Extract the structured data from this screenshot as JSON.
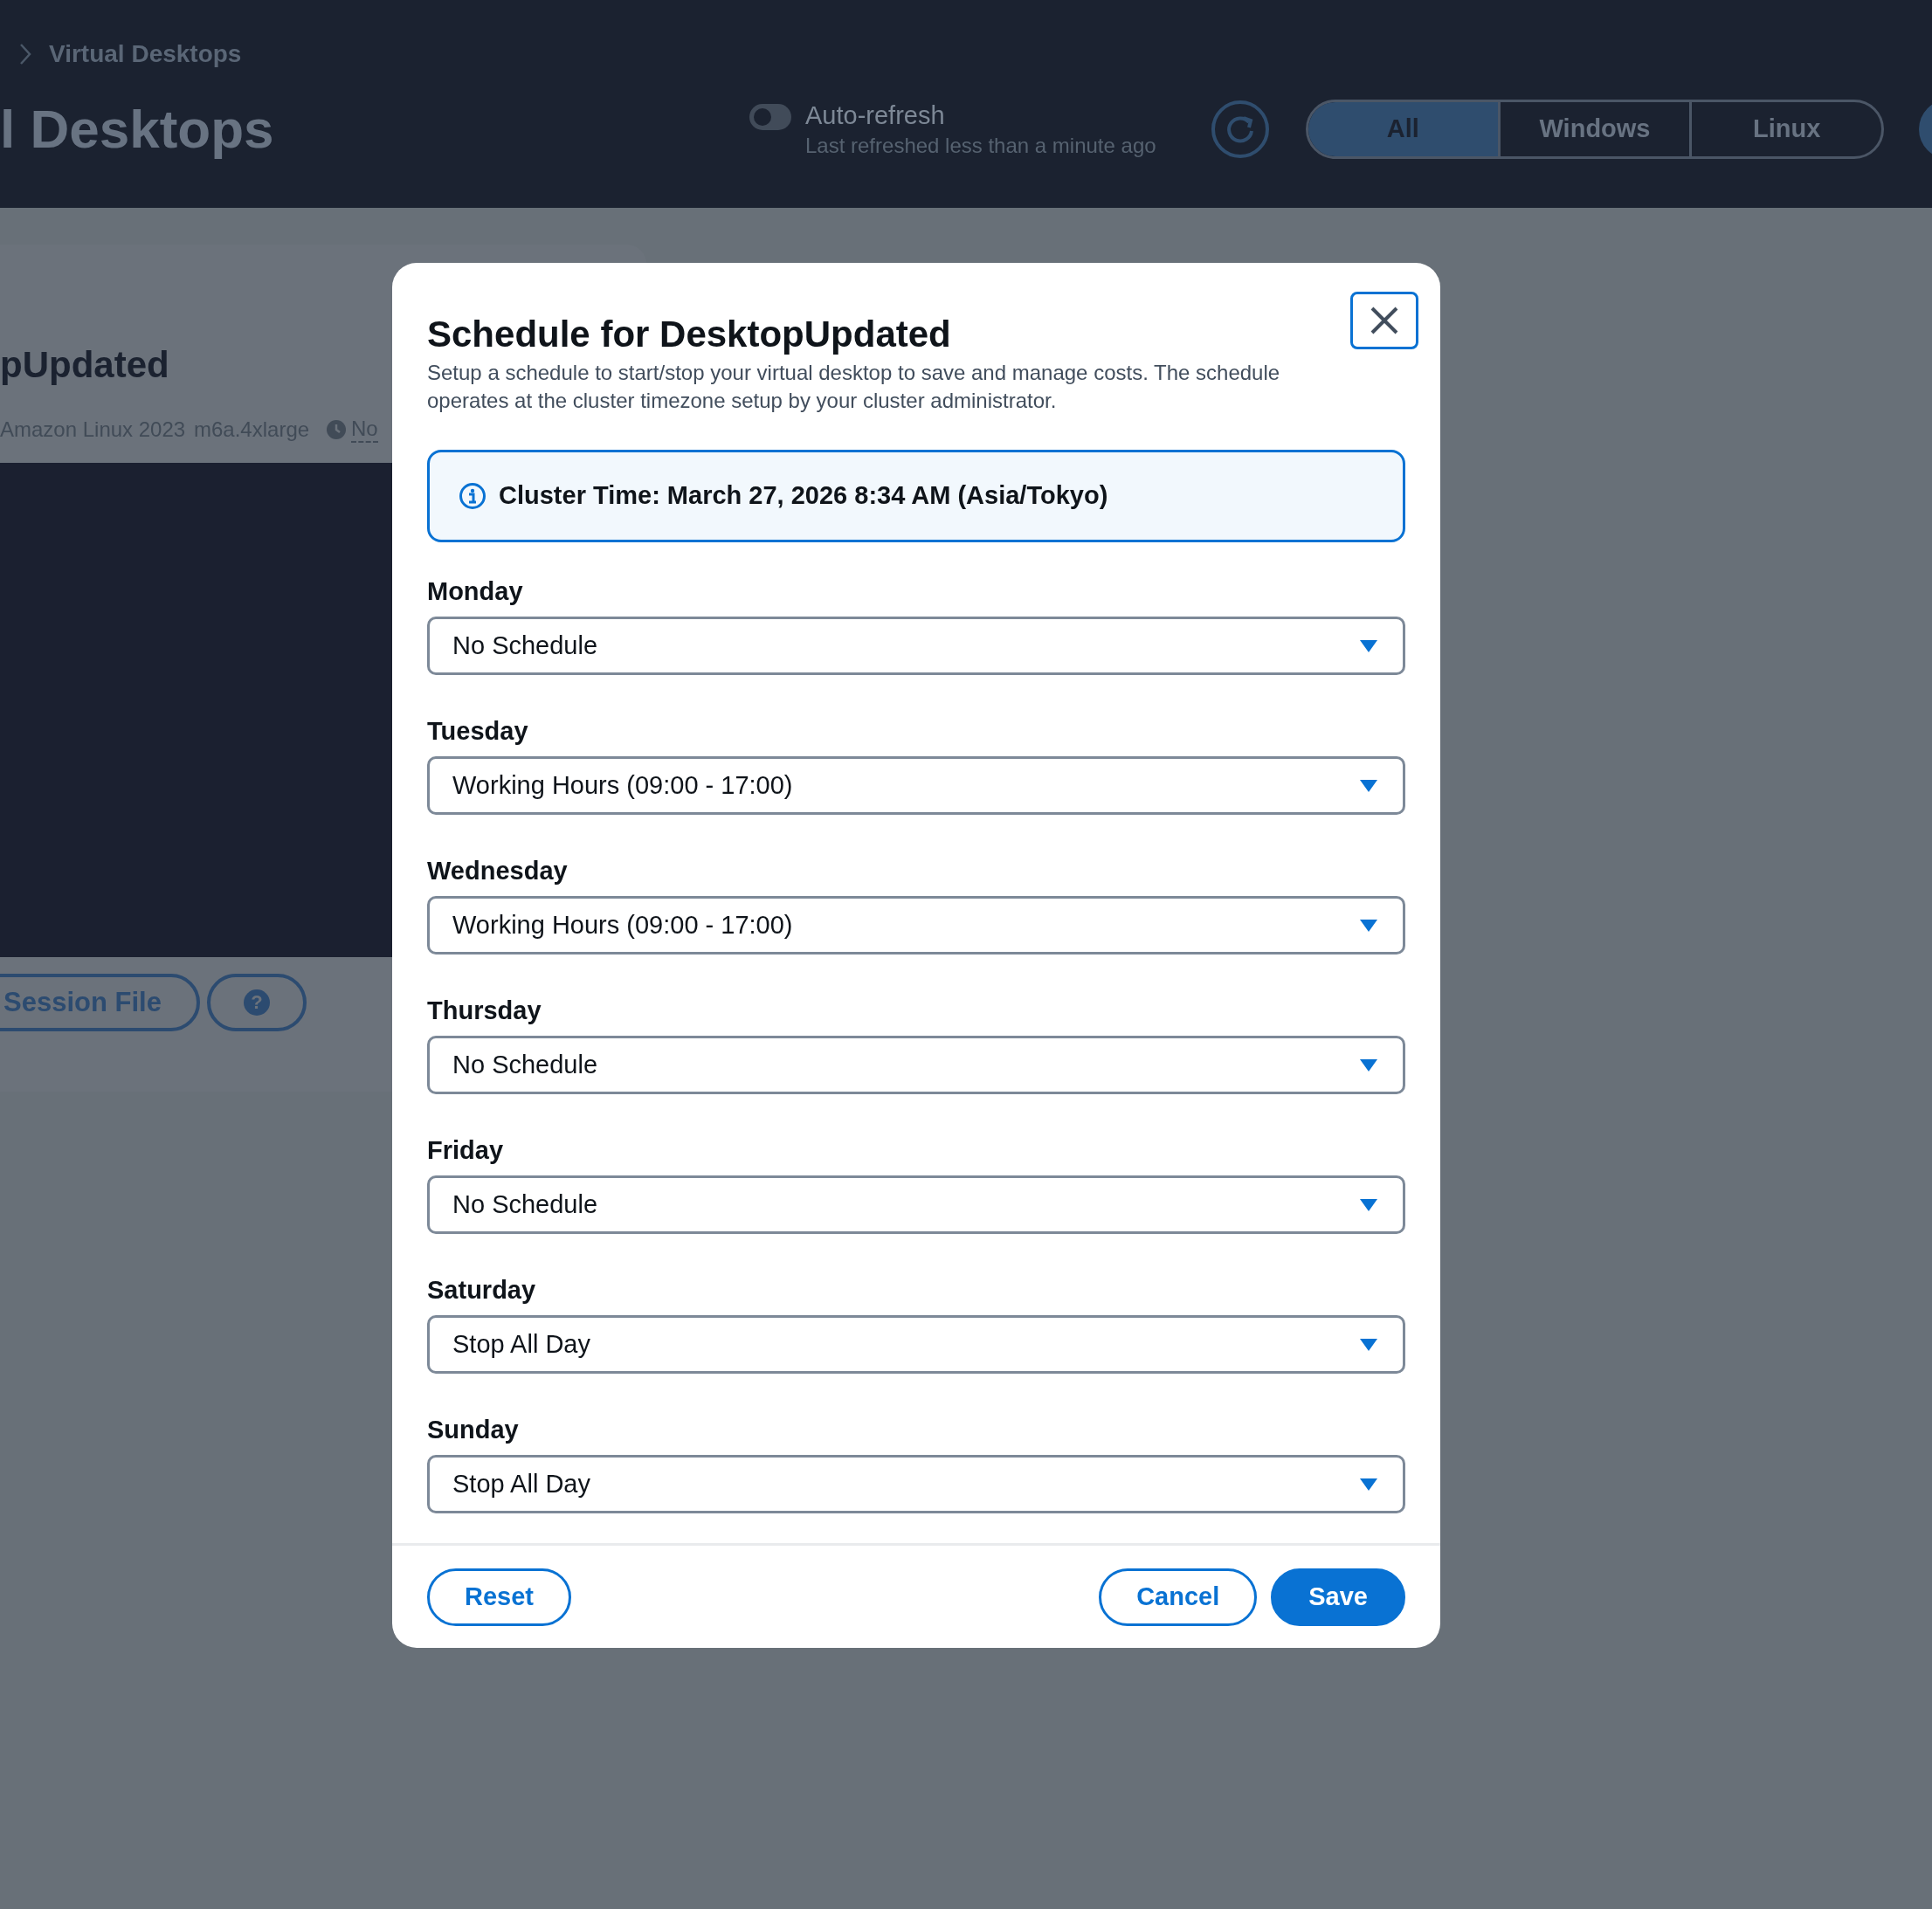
{
  "breadcrumb": [
    {
      "label": "Virtual Desktops"
    }
  ],
  "page_title": "l Desktops",
  "auto_refresh": {
    "label": "Auto-refresh",
    "on": false,
    "subtitle": "Last refreshed less than a minute ago"
  },
  "filter_tabs": [
    {
      "label": "All",
      "selected": true
    },
    {
      "label": "Windows",
      "selected": false
    },
    {
      "label": "Linux",
      "selected": false
    }
  ],
  "desktop_card": {
    "title": "pUpdated",
    "meta": [
      "Amazon Linux 2023",
      "m6a.4xlarge"
    ],
    "schedule": "No",
    "session_button": "Session File",
    "help_button": "?"
  },
  "modal": {
    "title": "Schedule for DesktopUpdated",
    "description": "Setup a schedule to start/stop your virtual desktop to save and manage costs. The schedule operates at the cluster timezone setup by your cluster administrator.",
    "info": "Cluster Time: March 27, 2026 8:34 AM (Asia/Tokyo)",
    "days": [
      {
        "label": "Monday",
        "value": "No Schedule"
      },
      {
        "label": "Tuesday",
        "value": "Working Hours (09:00 - 17:00)"
      },
      {
        "label": "Wednesday",
        "value": "Working Hours (09:00 - 17:00)"
      },
      {
        "label": "Thursday",
        "value": "No Schedule"
      },
      {
        "label": "Friday",
        "value": "No Schedule"
      },
      {
        "label": "Saturday",
        "value": "Stop All Day"
      },
      {
        "label": "Sunday",
        "value": "Stop All Day"
      }
    ],
    "footer_left": [
      {
        "label": "Reset",
        "kind": "secondary"
      }
    ],
    "footer_right": [
      {
        "label": "Cancel",
        "kind": "secondary"
      },
      {
        "label": "Save",
        "kind": "primary"
      }
    ]
  }
}
